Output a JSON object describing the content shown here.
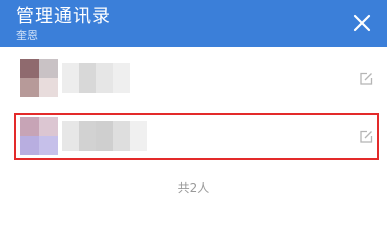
{
  "header": {
    "title": "管理通讯录",
    "subtitle": "奎恩",
    "background": "#3b7fd9"
  },
  "close_icon": "close-icon",
  "contacts": [
    {
      "avatar_colors": [
        "#8f6a6e",
        "#c9c2c5",
        "#b79a99",
        "#e8dcdc"
      ],
      "name_blur_colors": [
        "#ededed",
        "#d8d8d8",
        "#e6e6e6",
        "#efefef"
      ],
      "edit_icon": "edit-icon"
    },
    {
      "avatar_colors": [
        "#c7a4b6",
        "#dcc6d2",
        "#b8aee0",
        "#c6c0ea"
      ],
      "name_blur_colors": [
        "#e7e7e7",
        "#d2d2d2",
        "#cfcfcf",
        "#dedede",
        "#f0f0f0"
      ],
      "edit_icon": "edit-icon",
      "highlighted": true,
      "highlight_color": "#e32a2a"
    }
  ],
  "footer": {
    "count_text": "共2人"
  }
}
